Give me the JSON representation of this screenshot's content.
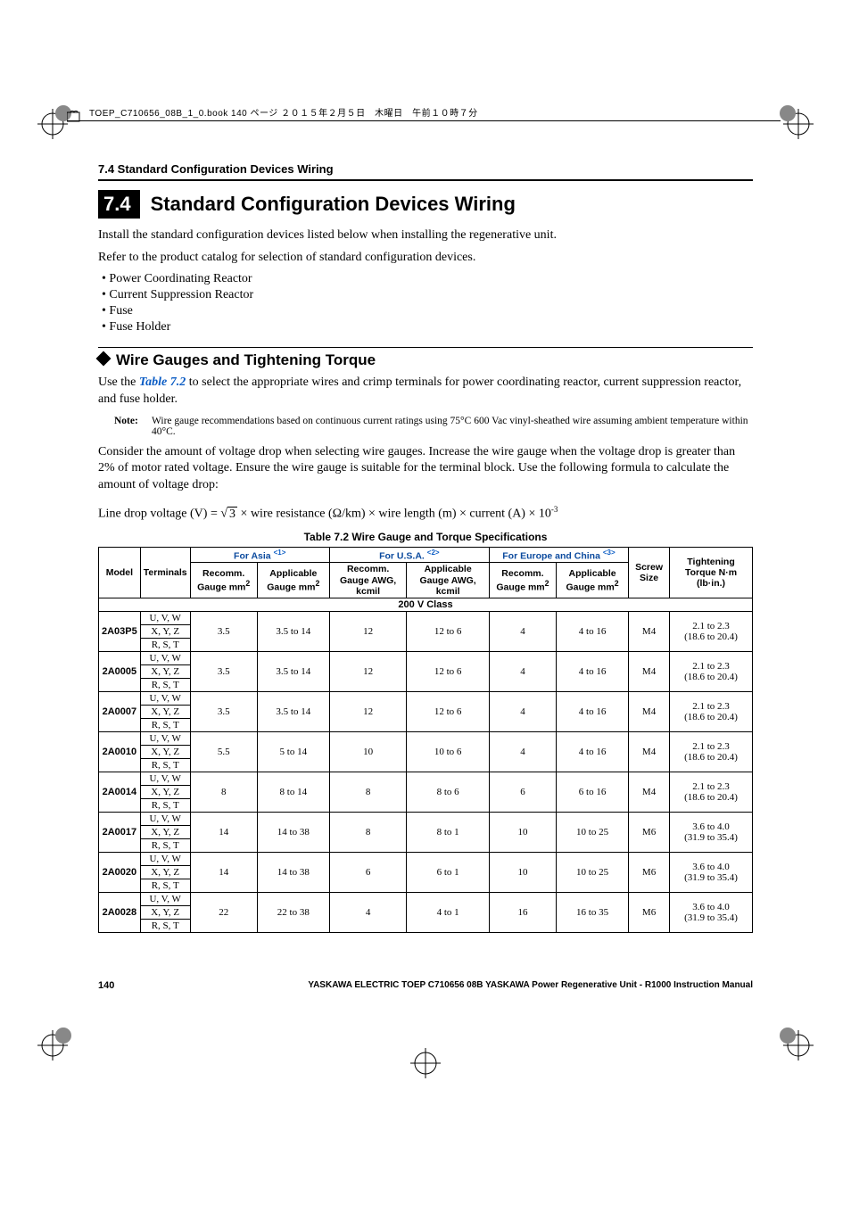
{
  "print_header": "TOEP_C710656_08B_1_0.book  140 ページ  ２０１５年２月５日　木曜日　午前１０時７分",
  "running_head": "7.4  Standard Configuration Devices Wiring",
  "chapter": {
    "num": "7.4",
    "title": "Standard Configuration Devices Wiring"
  },
  "intro_line1": "Install the standard configuration devices listed below when installing the regenerative unit.",
  "intro_line2": "Refer to the product catalog for selection of standard configuration devices.",
  "bullets": [
    "Power Coordinating Reactor",
    "Current Suppression Reactor",
    "Fuse",
    "Fuse Holder"
  ],
  "section_head": "Wire Gauges and Tightening Torque",
  "use_prefix": "Use the ",
  "table_ref": "Table 7.2",
  "use_suffix": " to select the appropriate wires and crimp terminals for power coordinating reactor, current suppression reactor, and fuse holder.",
  "note_label": "Note:",
  "note_text": "Wire gauge recommendations based on continuous current ratings using 75°C 600 Vac vinyl-sheathed wire assuming ambient temperature within 40°C.",
  "consider_text": "Consider the amount of voltage drop when selecting wire gauges. Increase the wire gauge when the voltage drop is greater than 2% of motor rated voltage. Ensure the wire gauge is suitable for the terminal block. Use the following formula to calculate the amount of voltage drop:",
  "formula": {
    "lhs": "Line drop voltage (V) = ",
    "sqrt3": "3",
    "tail": " × wire resistance (Ω/km) × wire length (m) × current (A) × 10",
    "exp": "-3"
  },
  "table_caption": "Table 7.2  Wire Gauge and Torque Specifications",
  "headers": {
    "model": "Model",
    "terminals": "Terminals",
    "asia": "For Asia ",
    "asia_ref": "<1>",
    "usa": "For U.S.A. ",
    "usa_ref": "<2>",
    "eu": "For Europe and China ",
    "eu_ref": "<3>",
    "screw": "Screw Size",
    "tight": "Tightening Torque N·m (lb·in.)",
    "recomm_mm": "Recomm. Gauge mm",
    "applic_mm": "Applicable Gauge mm",
    "recomm_awg": "Recomm. Gauge AWG, kcmil",
    "applic_awg": "Applicable Gauge AWG, kcmil",
    "sq": "2"
  },
  "voltage_class": "200 V Class",
  "terminal_rows": [
    "U, V, W",
    "X, Y, Z",
    "R, S, T"
  ],
  "rows": [
    {
      "model": "2A03P5",
      "asia_r": "3.5",
      "asia_a": "3.5 to 14",
      "usa_r": "12",
      "usa_a": "12 to 6",
      "eu_r": "4",
      "eu_a": "4 to 16",
      "screw": "M4",
      "torque_nm": "2.1 to 2.3",
      "torque_lb": "(18.6 to 20.4)"
    },
    {
      "model": "2A0005",
      "asia_r": "3.5",
      "asia_a": "3.5 to 14",
      "usa_r": "12",
      "usa_a": "12 to 6",
      "eu_r": "4",
      "eu_a": "4 to 16",
      "screw": "M4",
      "torque_nm": "2.1 to 2.3",
      "torque_lb": "(18.6 to 20.4)"
    },
    {
      "model": "2A0007",
      "asia_r": "3.5",
      "asia_a": "3.5 to 14",
      "usa_r": "12",
      "usa_a": "12 to 6",
      "eu_r": "4",
      "eu_a": "4 to 16",
      "screw": "M4",
      "torque_nm": "2.1 to 2.3",
      "torque_lb": "(18.6 to 20.4)"
    },
    {
      "model": "2A0010",
      "asia_r": "5.5",
      "asia_a": "5 to 14",
      "usa_r": "10",
      "usa_a": "10 to 6",
      "eu_r": "4",
      "eu_a": "4 to 16",
      "screw": "M4",
      "torque_nm": "2.1 to 2.3",
      "torque_lb": "(18.6 to 20.4)"
    },
    {
      "model": "2A0014",
      "asia_r": "8",
      "asia_a": "8 to 14",
      "usa_r": "8",
      "usa_a": "8 to 6",
      "eu_r": "6",
      "eu_a": "6 to 16",
      "screw": "M4",
      "torque_nm": "2.1 to 2.3",
      "torque_lb": "(18.6 to 20.4)"
    },
    {
      "model": "2A0017",
      "asia_r": "14",
      "asia_a": "14 to 38",
      "usa_r": "8",
      "usa_a": "8 to 1",
      "eu_r": "10",
      "eu_a": "10 to 25",
      "screw": "M6",
      "torque_nm": "3.6 to 4.0",
      "torque_lb": "(31.9 to 35.4)"
    },
    {
      "model": "2A0020",
      "asia_r": "14",
      "asia_a": "14 to 38",
      "usa_r": "6",
      "usa_a": "6 to 1",
      "eu_r": "10",
      "eu_a": "10 to 25",
      "screw": "M6",
      "torque_nm": "3.6 to 4.0",
      "torque_lb": "(31.9 to 35.4)"
    },
    {
      "model": "2A0028",
      "asia_r": "22",
      "asia_a": "22 to 38",
      "usa_r": "4",
      "usa_a": "4 to 1",
      "eu_r": "16",
      "eu_a": "16 to 35",
      "screw": "M6",
      "torque_nm": "3.6 to 4.0",
      "torque_lb": "(31.9 to 35.4)"
    }
  ],
  "footer": {
    "page": "140",
    "text": "YASKAWA ELECTRIC TOEP C710656 08B YASKAWA Power Regenerative Unit - R1000 Instruction Manual"
  }
}
